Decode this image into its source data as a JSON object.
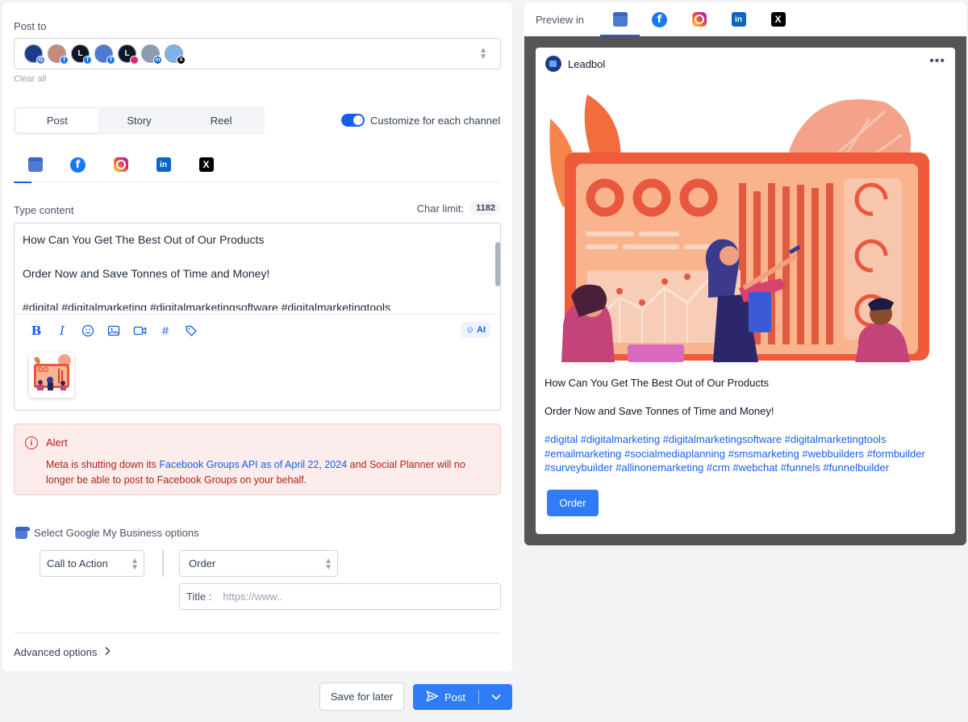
{
  "post_to": {
    "label": "Post to",
    "clear_all": "Clear all",
    "accounts": [
      {
        "name": "gmb-account",
        "initial": "",
        "bg": "#1d3b8a",
        "badge": "G",
        "badge_bg": "#4e7ad2"
      },
      {
        "name": "photo-account",
        "initial": "",
        "bg": "#c98a7a",
        "badge": "f",
        "badge_bg": "#1877f2"
      },
      {
        "name": "leadbol-account",
        "initial": "L",
        "bg": "#101828",
        "badge": "f",
        "badge_bg": "#1877f2"
      },
      {
        "name": "ring-account",
        "initial": "",
        "bg": "#4e7ad2",
        "badge": "f",
        "badge_bg": "#1877f2"
      },
      {
        "name": "leadbol-ig-account",
        "initial": "L",
        "bg": "#101828",
        "badge": "",
        "badge_bg": "#d62976"
      },
      {
        "name": "brand-li-account",
        "initial": "",
        "bg": "#8d9bb0",
        "badge": "in",
        "badge_bg": "#0a66c2"
      },
      {
        "name": "x-account",
        "initial": "",
        "bg": "#7db3e8",
        "badge": "X",
        "badge_bg": "#000000"
      }
    ]
  },
  "post_types": [
    "Post",
    "Story",
    "Reel"
  ],
  "customize_label": "Customize for each channel",
  "channel_icons": [
    "gmb-icon",
    "facebook-icon",
    "instagram-icon",
    "linkedin-icon",
    "x-icon"
  ],
  "content": {
    "label": "Type content",
    "char_limit_label": "Char limit:",
    "char_limit_value": "1182",
    "line1": "How Can You Get The Best Out of Our Products",
    "line2": "Order Now and Save Tonnes of Time and Money!",
    "line3": "#digital #digitalmarketing #digitalmarketingsoftware #digitalmarketingtools",
    "ai_label": "AI"
  },
  "alert": {
    "title": "Alert",
    "msg_pre": "Meta is shutting down its ",
    "msg_link": "Facebook Groups API as of April 22, 2024",
    "msg_post": " and Social Planner will no longer be able to post to Facebook Groups on your behalf."
  },
  "gmb_options": {
    "label": "Select Google My Business options",
    "cta_select": "Call to Action",
    "type_select": "Order",
    "title_label": "Title :",
    "title_placeholder": "https://www.."
  },
  "advanced_label": "Advanced options",
  "buttons": {
    "save_later": "Save for later",
    "post": "Post"
  },
  "preview": {
    "label": "Preview in",
    "account_name": "Leadbol",
    "more": "•••",
    "line1": "How Can You Get The Best Out of Our Products",
    "line2": "Order Now and Save Tonnes of Time and Money!",
    "hashtags": "#digital #digitalmarketing #digitalmarketingsoftware #digitalmarketingtools #emailmarketing #socialmediaplanning #smsmarketing #webbuilders #formbuilder #surveybuilder #allinonemarketing #crm #webchat #funnels #funnelbuilder",
    "button": "Order"
  },
  "colors": {
    "accent": "#155eef",
    "button": "#2f7cf6",
    "alert_bg": "#fceceb",
    "alert_text": "#b42318",
    "preview_stage": "#555457"
  }
}
